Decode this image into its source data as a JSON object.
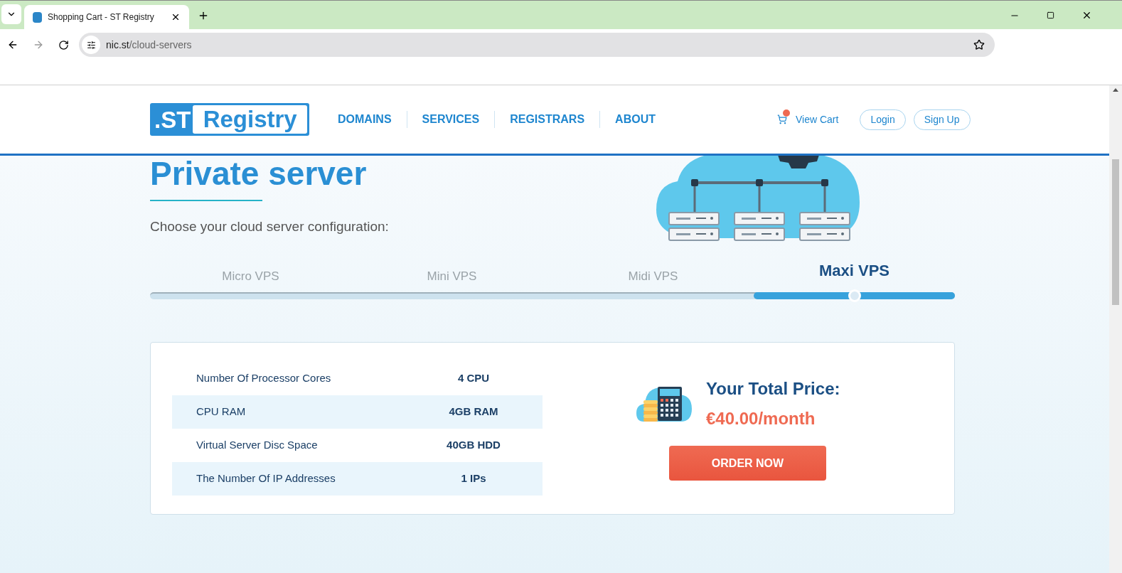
{
  "browser": {
    "tab": {
      "title": "Shopping Cart - ST Registry"
    },
    "address": {
      "host": "nic.st",
      "path": "/cloud-servers"
    }
  },
  "header": {
    "logo": {
      "left": ".ST",
      "right": "Registry"
    },
    "nav": [
      "DOMAINS",
      "SERVICES",
      "REGISTRARS",
      "ABOUT"
    ],
    "cart": "View Cart",
    "buttons": [
      "Login",
      "Sign Up"
    ]
  },
  "heading": "Private server",
  "subtitle": "Choose your cloud server configuration:",
  "slider": {
    "level": 0.875,
    "tiers": [
      {
        "label": "Micro VPS",
        "selected": false
      },
      {
        "label": "Mini VPS",
        "selected": false
      },
      {
        "label": "Midi VPS",
        "selected": false
      },
      {
        "label": "Maxi VPS",
        "selected": true
      }
    ]
  },
  "specs": [
    {
      "label": "Number Of Processor Cores",
      "value": "4 CPU"
    },
    {
      "label": "CPU RAM",
      "value": "4GB RAM"
    },
    {
      "label": "Virtual Server Disc Space",
      "value": "40GB HDD"
    },
    {
      "label": "The Number Of IP Addresses",
      "value": "1 IPs"
    }
  ],
  "price": {
    "title": "Your Total Price:",
    "amount": "€40.00/month",
    "button": "ORDER NOW"
  }
}
